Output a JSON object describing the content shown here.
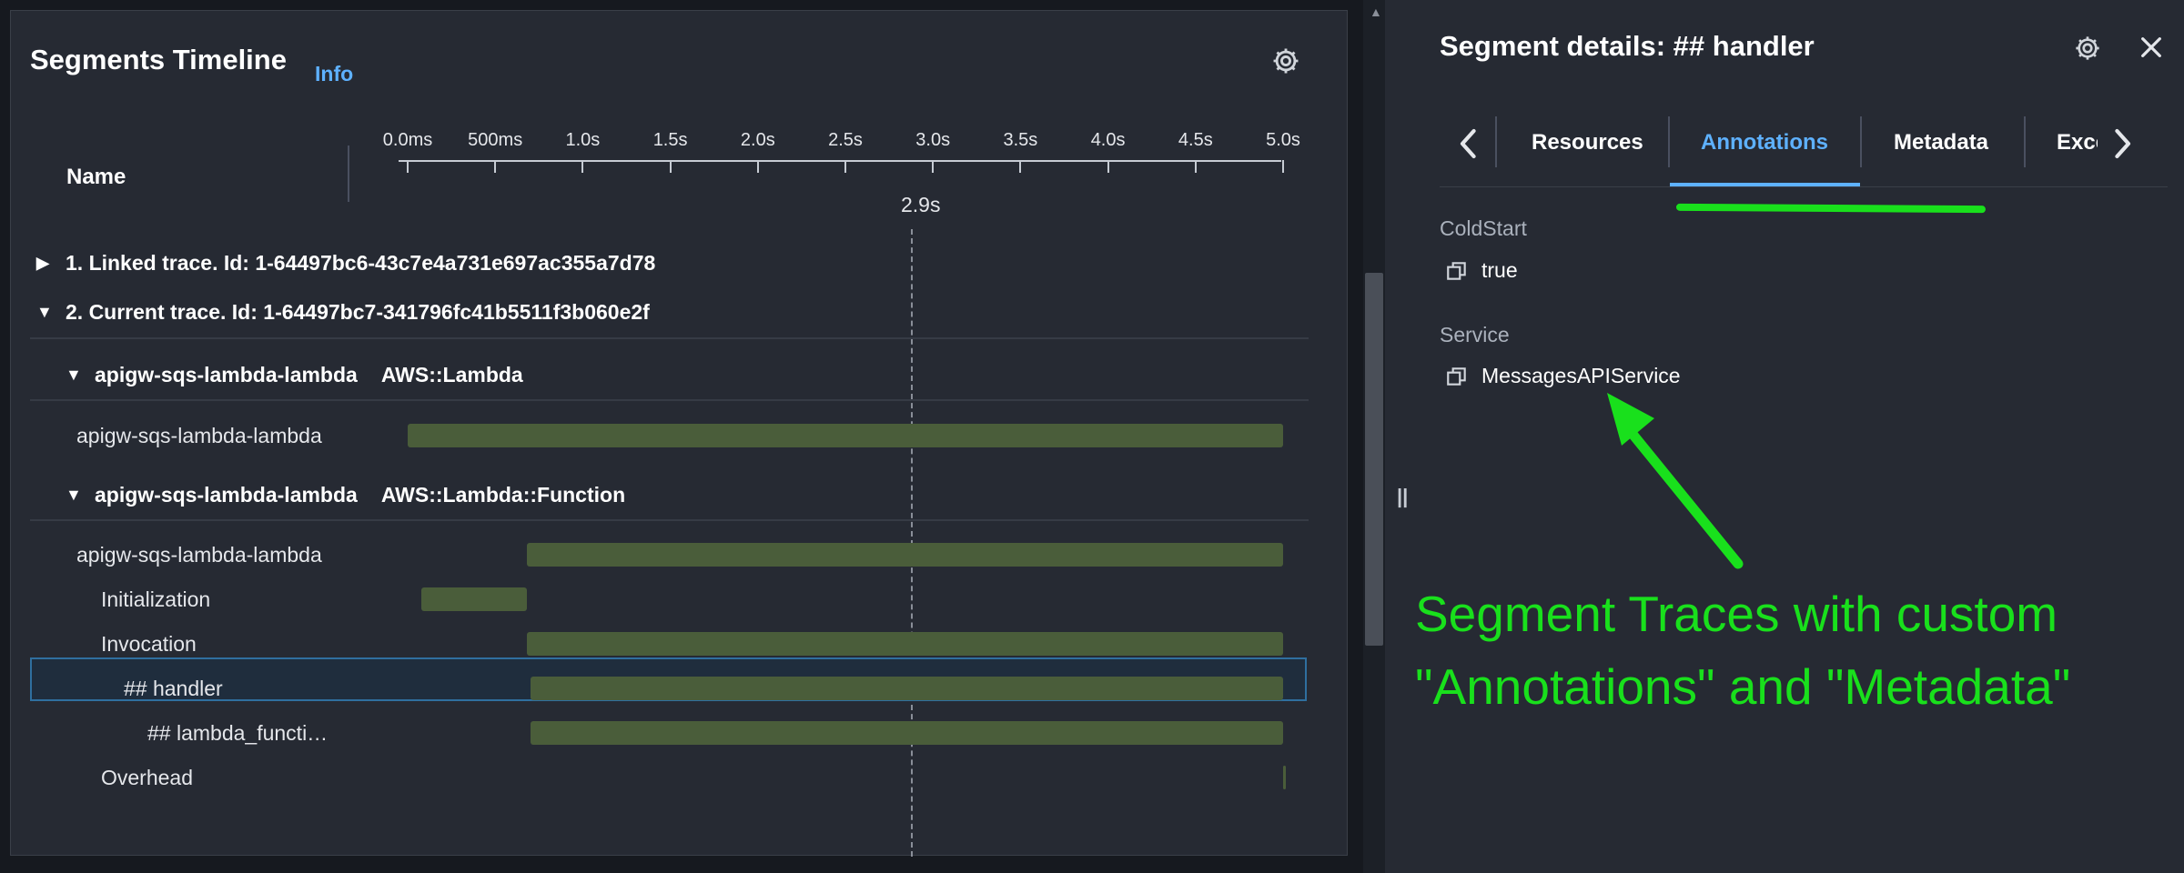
{
  "left_panel": {
    "title": "Segments Timeline",
    "info_label": "Info",
    "name_header": "Name",
    "axis_ticks": [
      "0.0ms",
      "500ms",
      "1.0s",
      "1.5s",
      "2.0s",
      "2.5s",
      "3.0s",
      "3.5s",
      "4.0s",
      "4.5s",
      "5.0s"
    ],
    "cursor_time": "2.9s",
    "traces": [
      {
        "label": "1. Linked trace. Id: 1-64497bc6-43c7e4a731e697ac355a7d78",
        "expanded": false
      },
      {
        "label": "2. Current trace. Id: 1-64497bc7-341796fc41b5511f3b060e2f",
        "expanded": true
      }
    ],
    "groups": [
      {
        "name": "apigw-sqs-lambda-lambda",
        "type": "AWS::Lambda"
      },
      {
        "name": "apigw-sqs-lambda-lambda",
        "type": "AWS::Lambda::Function"
      }
    ],
    "segments": [
      {
        "label": "apigw-sqs-lambda-lambda",
        "start_s": 0.0,
        "end_s": 5.0
      },
      {
        "label": "apigw-sqs-lambda-lambda",
        "start_s": 0.68,
        "end_s": 5.0
      },
      {
        "label": "Initialization",
        "start_s": 0.08,
        "end_s": 0.68
      },
      {
        "label": "Invocation",
        "start_s": 0.68,
        "end_s": 5.0
      },
      {
        "label": "## handler",
        "start_s": 0.7,
        "end_s": 5.0,
        "selected": true
      },
      {
        "label": "## lambda_functi…",
        "start_s": 0.7,
        "end_s": 5.0
      },
      {
        "label": "Overhead",
        "start_s": 5.0,
        "end_s": 5.01
      }
    ]
  },
  "right_panel": {
    "title": "Segment details: ## handler",
    "tabs": [
      "Resources",
      "Annotations",
      "Metadata",
      "Exce"
    ],
    "active_tab": "Annotations",
    "annotations": [
      {
        "key": "ColdStart",
        "value": "true"
      },
      {
        "key": "Service",
        "value": "MessagesAPIService"
      }
    ]
  },
  "overlay": {
    "line1": "Segment Traces with custom",
    "line2": "\"Annotations\" and \"Metadata\"",
    "color": "#19e01c"
  },
  "colors": {
    "accent": "#5eb1ff",
    "bar": "#4a5d3a",
    "panel_bg": "#262a33"
  },
  "icons": [
    "gear-icon",
    "close-icon",
    "chevron-left-icon",
    "chevron-right-icon",
    "copy-icon",
    "caret-right-icon",
    "caret-down-icon",
    "resize-handle-icon"
  ]
}
